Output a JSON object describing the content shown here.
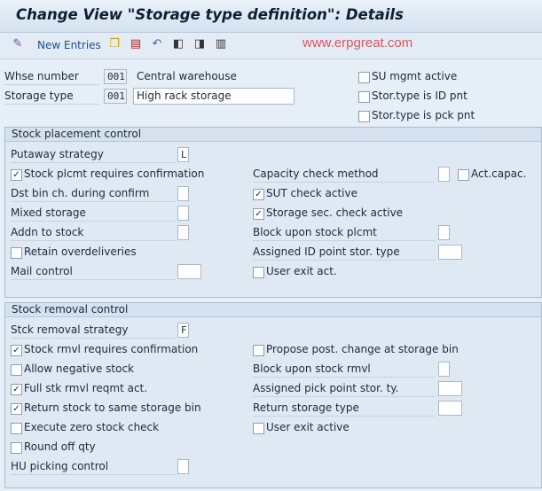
{
  "title": "Change View \"Storage type definition\": Details",
  "toolbar": {
    "new_entries": "New Entries",
    "icons": [
      "change-display-icon",
      "copy-icon",
      "delete-icon",
      "undo-icon",
      "previous-entry-icon",
      "next-entry-icon",
      "select-all-icon"
    ],
    "watermark": "www.erpgreat.com"
  },
  "header": {
    "whse_label": "Whse number",
    "whse_value": "001",
    "whse_desc": "Central warehouse",
    "stype_label": "Storage type",
    "stype_value": "001",
    "stype_desc": "High rack storage",
    "checks": [
      {
        "label": "SU mgmt active",
        "checked": false
      },
      {
        "label": "Stor.type is ID pnt",
        "checked": false
      },
      {
        "label": "Stor.type is pck pnt",
        "checked": false
      }
    ]
  },
  "placement": {
    "title": "Stock placement control",
    "left": [
      {
        "label": "Putaway strategy",
        "kind": "input",
        "value": "L"
      },
      {
        "label": "Stock plcmt requires confirmation",
        "kind": "check",
        "checked": true
      },
      {
        "label": "Dst bin ch. during confirm",
        "kind": "input",
        "value": ""
      },
      {
        "label": "Mixed storage",
        "kind": "input",
        "value": ""
      },
      {
        "label": "Addn to stock",
        "kind": "input",
        "value": ""
      },
      {
        "label": "Retain overdeliveries",
        "kind": "check",
        "checked": false
      },
      {
        "label": "Mail control",
        "kind": "input",
        "value": "",
        "wide": true
      }
    ],
    "right": [
      {
        "label": "Capacity check method",
        "kind": "input",
        "value": ""
      },
      {
        "label": "SUT check active",
        "kind": "check",
        "checked": true
      },
      {
        "label": "Storage sec. check active",
        "kind": "check",
        "checked": true
      },
      {
        "label": "Block upon stock plcmt",
        "kind": "input",
        "value": ""
      },
      {
        "label": "Assigned ID point stor. type",
        "kind": "input",
        "value": "",
        "wide": true
      },
      {
        "label": "User exit act.",
        "kind": "check",
        "checked": false
      }
    ],
    "act_capac": {
      "label": "Act.capac.",
      "checked": false
    }
  },
  "removal": {
    "title": "Stock removal control",
    "left": [
      {
        "label": "Stck removal strategy",
        "kind": "input",
        "value": "F"
      },
      {
        "label": "Stock rmvl requires confirmation",
        "kind": "check",
        "checked": true
      },
      {
        "label": "Allow negative stock",
        "kind": "check",
        "checked": false
      },
      {
        "label": "Full stk rmvl reqmt act.",
        "kind": "check",
        "checked": true
      },
      {
        "label": "Return stock to same storage bin",
        "kind": "check",
        "checked": true
      },
      {
        "label": "Execute zero stock check",
        "kind": "check",
        "checked": false
      },
      {
        "label": "Round off qty",
        "kind": "check",
        "checked": false
      },
      {
        "label": "HU picking control",
        "kind": "input",
        "value": ""
      }
    ],
    "right": [
      {
        "label": "Propose post. change at storage bin",
        "kind": "check",
        "checked": false
      },
      {
        "label": "Block upon stock rmvl",
        "kind": "input",
        "value": ""
      },
      {
        "label": "Assigned pick point stor. ty.",
        "kind": "input",
        "value": "",
        "wide": true
      },
      {
        "label": "Return storage type",
        "kind": "input",
        "value": "",
        "wide": true
      },
      {
        "label": "User exit active",
        "kind": "check",
        "checked": false
      }
    ]
  }
}
